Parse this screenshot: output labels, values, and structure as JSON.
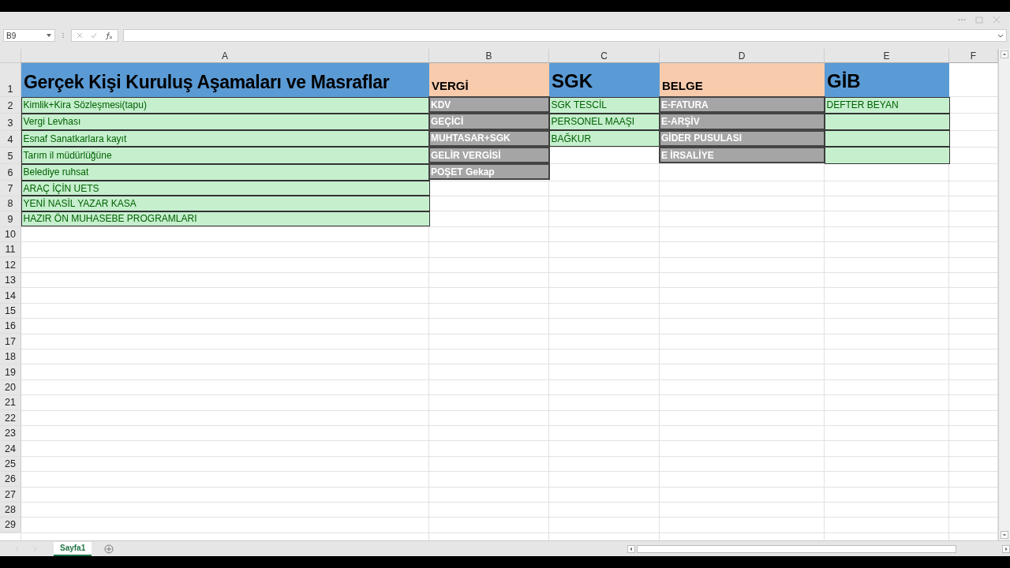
{
  "name_box": {
    "value": "B9"
  },
  "columns": [
    "A",
    "B",
    "C",
    "D",
    "E",
    "F"
  ],
  "rows": [
    {
      "number": "1",
      "cells": [
        {
          "kind": "title",
          "text": "Gerçek Kişi Kuruluş Aşamaları ve Masraflar"
        },
        {
          "kind": "peach",
          "text": "VERGİ"
        },
        {
          "kind": "heading",
          "text": "SGK"
        },
        {
          "kind": "peach",
          "text": "BELGE"
        },
        {
          "kind": "heading",
          "text": "GİB"
        }
      ]
    },
    {
      "number": "2",
      "cells": [
        {
          "kind": "good",
          "text": "Kimlik+Kira Sözleşmesi(tapu)"
        },
        {
          "kind": "muted",
          "text": "KDV"
        },
        {
          "kind": "good",
          "text": "SGK TESCİL"
        },
        {
          "kind": "muted",
          "text": "E-FATURA"
        },
        {
          "kind": "good",
          "text": "DEFTER BEYAN"
        }
      ]
    },
    {
      "number": "3",
      "cells": [
        {
          "kind": "good",
          "text": "Vergi Levhası"
        },
        {
          "kind": "muted",
          "text": "GEÇİCİ"
        },
        {
          "kind": "good",
          "text": "PERSONEL MAAŞI"
        },
        {
          "kind": "muted",
          "text": "E-ARŞİV"
        },
        {
          "kind": "good"
        }
      ]
    },
    {
      "number": "4",
      "cells": [
        {
          "kind": "good",
          "text": "Esnaf Sanatkarlara kayıt"
        },
        {
          "kind": "muted",
          "text": "MUHTASAR+SGK"
        },
        {
          "kind": "good",
          "text": "BAĞKUR"
        },
        {
          "kind": "muted",
          "text": "GİDER PUSULASI"
        },
        {
          "kind": "good"
        }
      ]
    },
    {
      "number": "5",
      "cells": [
        {
          "kind": "good",
          "text": "Tarım il müdürlüğüne"
        },
        {
          "kind": "muted",
          "text": "GELİR VERGİSİ"
        },
        {},
        {
          "kind": "muted",
          "text": "E İRSALİYE"
        },
        {
          "kind": "good"
        }
      ]
    },
    {
      "number": "6",
      "cells": [
        {
          "kind": "good",
          "text": "Belediye ruhsat"
        },
        {
          "kind": "muted",
          "text": "POŞET Gekap"
        }
      ]
    },
    {
      "number": "7",
      "cells": [
        {
          "kind": "good",
          "text": "ARAÇ İÇİN UETS"
        }
      ]
    },
    {
      "number": "8",
      "cells": [
        {
          "kind": "good",
          "text": "YENİ NASİL YAZAR KASA"
        }
      ]
    },
    {
      "number": "9",
      "cells": [
        {
          "kind": "good",
          "text": "HAZIR ÖN MUHASEBE PROGRAMLARI"
        }
      ]
    },
    {
      "number": "10"
    },
    {
      "number": "11"
    },
    {
      "number": "12"
    },
    {
      "number": "13"
    },
    {
      "number": "14"
    },
    {
      "number": "15"
    },
    {
      "number": "16"
    },
    {
      "number": "17"
    },
    {
      "number": "18"
    },
    {
      "number": "19"
    },
    {
      "number": "20"
    },
    {
      "number": "21"
    },
    {
      "number": "22"
    },
    {
      "number": "23"
    },
    {
      "number": "24"
    },
    {
      "number": "25"
    },
    {
      "number": "26"
    },
    {
      "number": "27"
    },
    {
      "number": "28"
    },
    {
      "number": "29"
    }
  ],
  "sheet_tabs": [
    {
      "label": "Sayfa1",
      "selected": true
    }
  ]
}
